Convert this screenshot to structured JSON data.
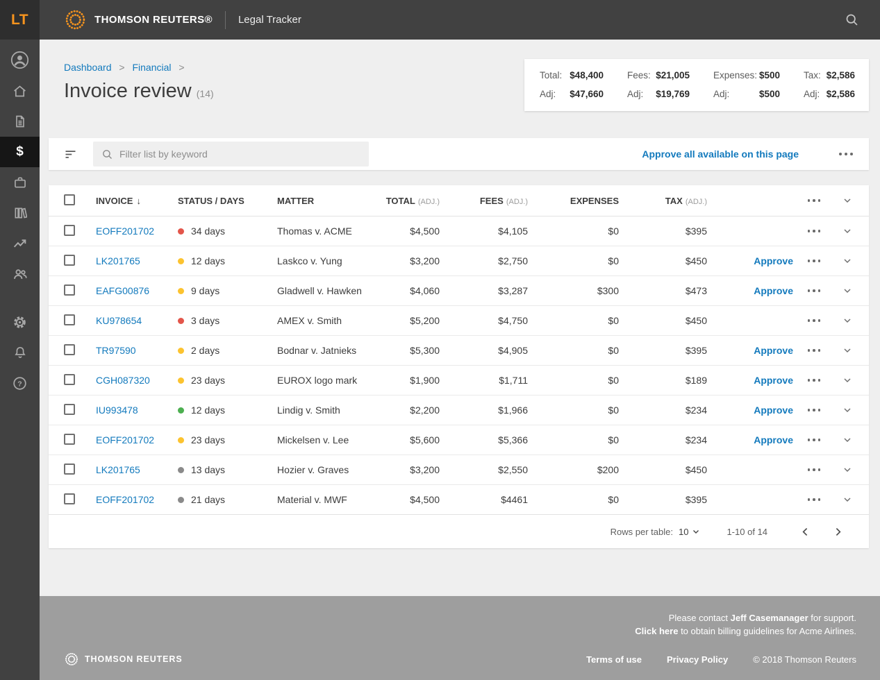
{
  "app": {
    "logo_initials": "LT",
    "brand": "THOMSON REUTERS®",
    "product": "Legal Tracker"
  },
  "icons": {
    "financial_glyph": "$",
    "help_glyph": "?"
  },
  "sidebar": {
    "items": [
      "profile",
      "home",
      "documents",
      "financial",
      "matters",
      "library",
      "reports",
      "contacts",
      "settings",
      "notifications",
      "help"
    ],
    "active": "financial"
  },
  "breadcrumb": {
    "items": [
      "Dashboard",
      "Financial"
    ],
    "separator": ">"
  },
  "page": {
    "title": "Invoice review",
    "count": "(14)"
  },
  "summary": {
    "columns": [
      {
        "label": "Total:",
        "value": "$48,400",
        "adj_label": "Adj:",
        "adj_value": "$47,660"
      },
      {
        "label": "Fees:",
        "value": "$21,005",
        "adj_label": "Adj:",
        "adj_value": "$19,769"
      },
      {
        "label": "Expenses:",
        "value": "$500",
        "adj_label": "Adj:",
        "adj_value": "$500"
      },
      {
        "label": "Tax:",
        "value": "$2,586",
        "adj_label": "Adj:",
        "adj_value": "$2,586"
      }
    ]
  },
  "toolbar": {
    "filter_placeholder": "Filter list by keyword",
    "approve_all_label": "Approve all available on this page"
  },
  "table": {
    "headers": [
      {
        "label": "INVOICE",
        "sort": "↓"
      },
      {
        "label": "STATUS / DAYS"
      },
      {
        "label": "MATTER"
      },
      {
        "label": "TOTAL",
        "sub": "(ADJ.)"
      },
      {
        "label": "FEES",
        "sub": "(ADJ.)"
      },
      {
        "label": "EXPENSES"
      },
      {
        "label": "TAX",
        "sub": "(ADJ.)"
      }
    ],
    "approve_label": "Approve",
    "rows": [
      {
        "invoice": "EOFF201702",
        "status": "red",
        "days": "34 days",
        "matter": "Thomas v. ACME",
        "total": "$4,500",
        "fees": "$4,105",
        "expenses": "$0",
        "tax": "$395",
        "approve": false
      },
      {
        "invoice": "LK201765",
        "status": "yellow",
        "days": "12 days",
        "matter": "Laskco v. Yung",
        "total": "$3,200",
        "fees": "$2,750",
        "expenses": "$0",
        "tax": "$450",
        "approve": true
      },
      {
        "invoice": "EAFG00876",
        "status": "yellow",
        "days": "9 days",
        "matter": "Gladwell v. Hawken",
        "total": "$4,060",
        "fees": "$3,287",
        "expenses": "$300",
        "tax": "$473",
        "approve": true
      },
      {
        "invoice": "KU978654",
        "status": "red",
        "days": "3 days",
        "matter": "AMEX v. Smith",
        "total": "$5,200",
        "fees": "$4,750",
        "expenses": "$0",
        "tax": "$450",
        "approve": false
      },
      {
        "invoice": "TR97590",
        "status": "yellow",
        "days": "2 days",
        "matter": "Bodnar v. Jatnieks",
        "total": "$5,300",
        "fees": "$4,905",
        "expenses": "$0",
        "tax": "$395",
        "approve": true
      },
      {
        "invoice": "CGH087320",
        "status": "yellow",
        "days": "23 days",
        "matter": "EUROX logo mark",
        "total": "$1,900",
        "fees": "$1,711",
        "expenses": "$0",
        "tax": "$189",
        "approve": true
      },
      {
        "invoice": "IU993478",
        "status": "green",
        "days": "12 days",
        "matter": "Lindig v. Smith",
        "total": "$2,200",
        "fees": "$1,966",
        "expenses": "$0",
        "tax": "$234",
        "approve": true
      },
      {
        "invoice": "EOFF201702",
        "status": "yellow",
        "days": "23 days",
        "matter": "Mickelsen v. Lee",
        "total": "$5,600",
        "fees": "$5,366",
        "expenses": "$0",
        "tax": "$234",
        "approve": true
      },
      {
        "invoice": "LK201765",
        "status": "gray",
        "days": "13 days",
        "matter": "Hozier v. Graves",
        "total": "$3,200",
        "fees": "$2,550",
        "expenses": "$200",
        "tax": "$450",
        "approve": false
      },
      {
        "invoice": "EOFF201702",
        "status": "gray",
        "days": "21 days",
        "matter": "Material v. MWF",
        "total": "$4,500",
        "fees": "$4461",
        "expenses": "$0",
        "tax": "$395",
        "approve": false
      }
    ]
  },
  "pagination": {
    "rows_label": "Rows per table:",
    "rows_value": "10",
    "range": "1-10 of 14"
  },
  "footer": {
    "support_prefix": "Please contact ",
    "support_name": "Jeff Casemanager",
    "support_suffix": " for support.",
    "guidelines_link": "Click here",
    "guidelines_suffix": " to obtain billing guidelines for Acme Airlines.",
    "brand": "THOMSON REUTERS",
    "links": [
      "Terms of use",
      "Privacy Policy"
    ],
    "copyright": "© 2018 Thomson Reuters"
  },
  "colors": {
    "accent_orange": "#f7941e",
    "link_blue": "#137abd",
    "status": {
      "red": "#e3554a",
      "yellow": "#fcc32f",
      "green": "#4caf50",
      "gray": "#8a8a8a"
    }
  }
}
